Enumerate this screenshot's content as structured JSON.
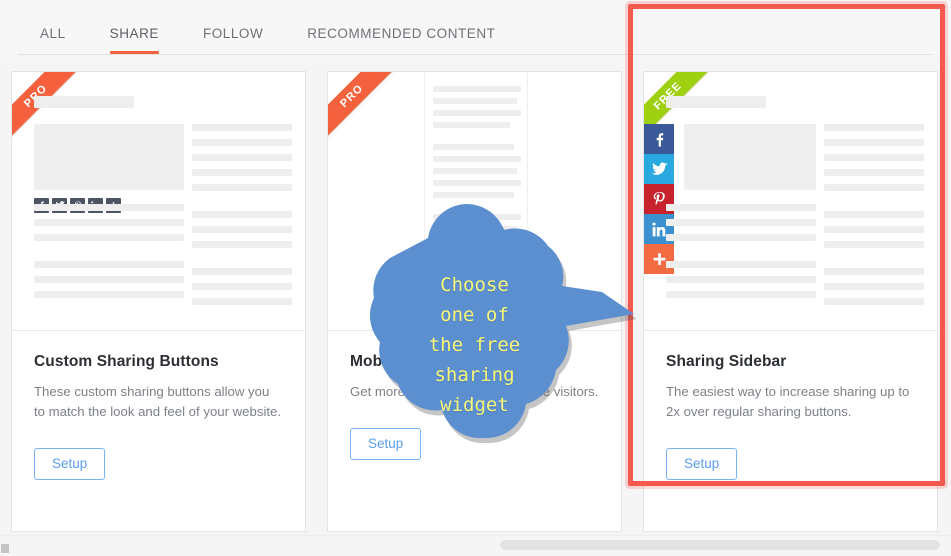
{
  "tabs": [
    {
      "label": "ALL",
      "active": false
    },
    {
      "label": "SHARE",
      "active": true
    },
    {
      "label": "FOLLOW",
      "active": false
    },
    {
      "label": "RECOMMENDED CONTENT",
      "active": false
    }
  ],
  "colors": {
    "accent": "#f4613c",
    "selection": "#f4584f",
    "ribbon_pro": "#f4613c",
    "ribbon_free": "#9ed011",
    "setup_button": "#5b9ef0",
    "callout_fill": "#5b8fd0",
    "callout_text": "#f7f77a",
    "facebook": "#3b5998",
    "twitter": "#29a9e0",
    "pinterest": "#c8232c",
    "linkedin": "#3b91cf",
    "addthis": "#f26b42",
    "dark_button": "#4d5563"
  },
  "cards": [
    {
      "ribbon": "PRO",
      "ribbon_type": "pro",
      "preview": "custom-sharing-buttons-preview",
      "title": "Custom Sharing Buttons",
      "description": "These custom sharing buttons allow you to match the look and feel of your website.",
      "setup_label": "Setup",
      "selected": false
    },
    {
      "ribbon": "PRO",
      "ribbon_type": "pro",
      "preview": "mobile-sharing-preview",
      "title": "Mobile Sharing Buttons",
      "description": "Get more shares from your mobile visitors.",
      "setup_label": "Setup",
      "selected": false
    },
    {
      "ribbon": "FREE",
      "ribbon_type": "free",
      "preview": "sharing-sidebar-preview",
      "title": "Sharing Sidebar",
      "description": "The easiest way to increase sharing up to 2x over regular sharing buttons.",
      "setup_label": "Setup",
      "selected": true
    }
  ],
  "social_icons": [
    "facebook",
    "twitter",
    "pinterest",
    "linkedin",
    "addthis"
  ],
  "callout": {
    "text": "Choose\none of\nthe free\nsharing\nwidget"
  }
}
